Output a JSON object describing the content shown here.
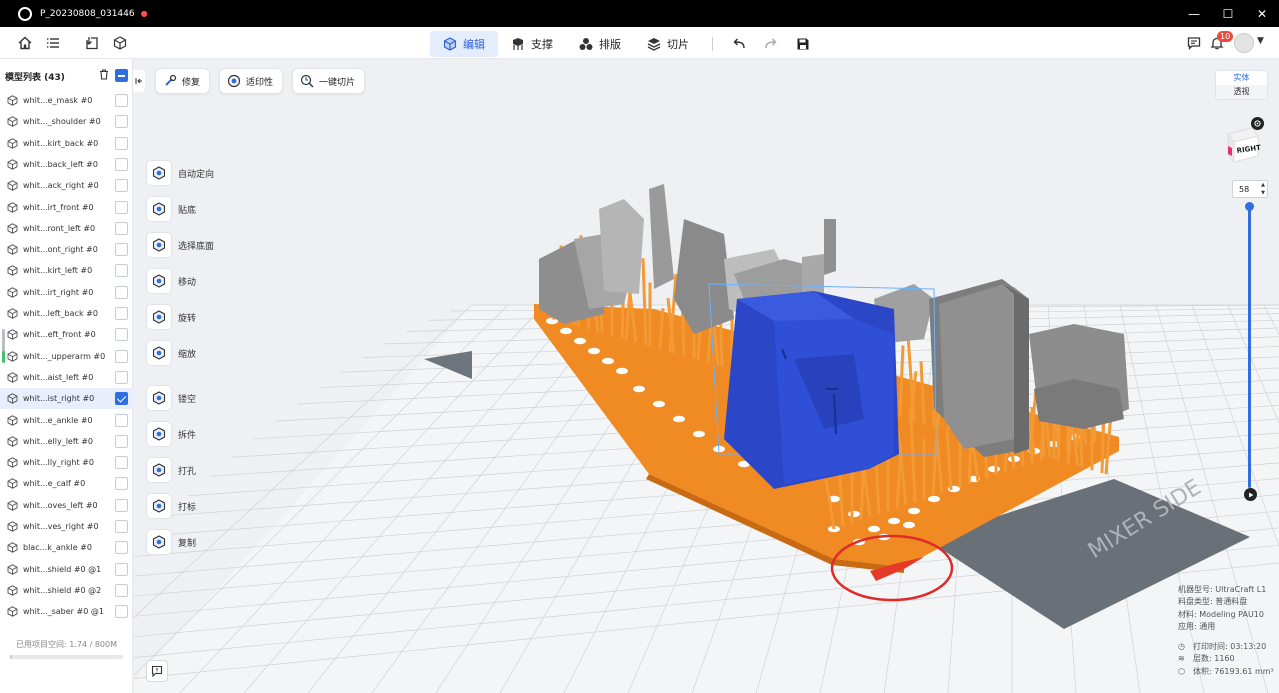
{
  "window": {
    "title": "P_20230808_031446",
    "unsaved_dot": "●",
    "min": "—",
    "max": "☐",
    "close": "✕"
  },
  "toolbar": {
    "home_icon": "home-icon",
    "list_icon": "list-icon",
    "import_icon": "import-icon",
    "cube_icon": "cube-icon",
    "modes": [
      {
        "label": "编辑",
        "icon": "edit-cube-icon"
      },
      {
        "label": "支撑",
        "icon": "support-icon"
      },
      {
        "label": "排版",
        "icon": "layout-icon"
      },
      {
        "label": "切片",
        "icon": "slice-icon"
      }
    ],
    "active_mode": 0,
    "notification_count": "10",
    "accent": "#2f6de1"
  },
  "left_panel": {
    "title": "模型列表 (43)",
    "models": [
      {
        "name": "whit...e_mask #0",
        "checked": false
      },
      {
        "name": "whit..._shoulder #0",
        "checked": false
      },
      {
        "name": "whit...kirt_back #0",
        "checked": false
      },
      {
        "name": "whit...back_left #0",
        "checked": false
      },
      {
        "name": "whit...ack_right #0",
        "checked": false
      },
      {
        "name": "whit...irt_front #0",
        "checked": false
      },
      {
        "name": "whit...ront_left #0",
        "checked": false
      },
      {
        "name": "whit...ont_right #0",
        "checked": false
      },
      {
        "name": "whit...kirt_left #0",
        "checked": false
      },
      {
        "name": "whit...irt_right #0",
        "checked": false
      },
      {
        "name": "whit...left_back #0",
        "checked": false
      },
      {
        "name": "whit...eft_front #0",
        "checked": false
      },
      {
        "name": "whit..._upperarm #0",
        "checked": false
      },
      {
        "name": "whit...aist_left #0",
        "checked": false
      },
      {
        "name": "whit...ist_right #0",
        "checked": true
      },
      {
        "name": "whit...e_ankle #0",
        "checked": false
      },
      {
        "name": "whit...elly_left #0",
        "checked": false
      },
      {
        "name": "whit...lly_right #0",
        "checked": false
      },
      {
        "name": "whit...e_calf #0",
        "checked": false
      },
      {
        "name": "whit...oves_left #0",
        "checked": false
      },
      {
        "name": "whit...ves_right #0",
        "checked": false
      },
      {
        "name": "blac...k_ankle #0",
        "checked": false
      },
      {
        "name": "whit...shield #0 @1",
        "checked": false
      },
      {
        "name": "whit...shield #0 @2",
        "checked": false
      },
      {
        "name": "whit..._saber #0 @1",
        "checked": false
      }
    ],
    "storage": "已用项目空间: 1.74 / 800M",
    "storage_fraction": 0.002
  },
  "chips": [
    {
      "label": "修复",
      "icon": "repair-icon"
    },
    {
      "label": "适印性",
      "icon": "printability-icon"
    },
    {
      "label": "一键切片",
      "icon": "one-click-slice-icon"
    }
  ],
  "tools": [
    {
      "label": "自动定向",
      "icon": "auto-orient-icon"
    },
    {
      "label": "贴底",
      "icon": "lay-flat-icon"
    },
    {
      "label": "选择底面",
      "icon": "select-face-icon"
    },
    {
      "label": "移动",
      "icon": "move-icon"
    },
    {
      "label": "旋转",
      "icon": "rotate-icon"
    },
    {
      "label": "缩放",
      "icon": "scale-icon"
    },
    {
      "label": "镂空",
      "icon": "hollow-icon"
    },
    {
      "label": "拆件",
      "icon": "split-icon"
    },
    {
      "label": "打孔",
      "icon": "drill-icon"
    },
    {
      "label": "打标",
      "icon": "label-icon"
    },
    {
      "label": "复制",
      "icon": "duplicate-icon"
    }
  ],
  "view": {
    "solid_label": "实体",
    "perspective_label": "透视",
    "cube_face": "RIGHT",
    "layer_value": "58",
    "layer_fraction": 1.0
  },
  "scene": {
    "plate_text": "MIXER SIDE"
  },
  "info": {
    "machine": "机器型号: UltraCraft L1",
    "tray": "料盘类型: 普通料盘",
    "material": "材料: Modeling PAU10",
    "application": "应用: 通用",
    "print_time": "打印时间: 03:13:20",
    "layers": "层数: 1160",
    "volume": "体积: 76193.61 mm³"
  }
}
